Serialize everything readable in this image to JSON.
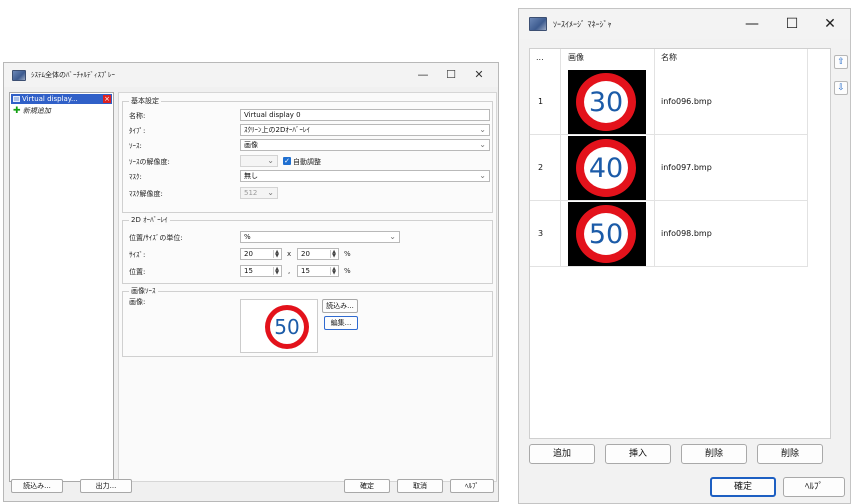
{
  "dialog": {
    "title": "ｼｽﾃﾑ全体のﾊﾞｰﾁｬﾙﾃﾞｨｽﾌﾟﾚｰ",
    "tree": {
      "selected": "Virtual display...",
      "add_new": "新規追加"
    },
    "basic": {
      "group_title": "基本設定",
      "name_label": "名称:",
      "name_value": "Virtual display 0",
      "type_label": "ﾀｲﾌﾟ:",
      "type_value": "ｽｸﾘｰﾝ上の2Dｵｰﾊﾞｰﾚｲ",
      "source_label": "ｿｰｽ:",
      "source_value": "画像",
      "resolution_label": "ｿｰｽの解像度:",
      "resolution_value": "",
      "auto_adjust_label": "自動調整",
      "auto_adjust_checked": true,
      "mask_label": "ﾏｽｸ:",
      "mask_value": "無し",
      "mask_res_label": "ﾏｽｸ解像度:",
      "mask_res_value": "512"
    },
    "overlay": {
      "group_title": "2D ｵｰﾊﾞｰﾚｲ",
      "unit_label": "位置/ｻｲｽﾞの単位:",
      "unit_value": "%",
      "size_label": "ｻｲｽﾞ:",
      "size_w": "20",
      "size_x_sep": "x",
      "size_h": "20",
      "size_unit": "%",
      "pos_label": "位置:",
      "pos_x": "15",
      "pos_sep": ",",
      "pos_y": "15",
      "pos_unit": "%"
    },
    "image_source": {
      "group_title": "画像ｿｰｽ",
      "image_label": "画像:",
      "preview_number": "50",
      "load_button": "読込み...",
      "edit_button": "編集..."
    },
    "footer": {
      "load": "読込み...",
      "export": "出力...",
      "ok": "確定",
      "cancel": "取消",
      "help": "ﾍﾙﾌﾟ"
    },
    "window_controls": {
      "min": "—",
      "max": "☐",
      "close": "✕"
    }
  },
  "manager": {
    "title": "ｿｰｽｲﾒｰｼﾞ ﾏﾈｰｼﾞｬ",
    "columns": {
      "index": "...",
      "image": "画像",
      "name": "名称"
    },
    "rows": [
      {
        "index": "1",
        "number": "30",
        "file": "info096.bmp"
      },
      {
        "index": "2",
        "number": "40",
        "file": "info097.bmp"
      },
      {
        "index": "3",
        "number": "50",
        "file": "info098.bmp"
      }
    ],
    "buttons": {
      "add": "追加",
      "insert": "挿入",
      "delete1": "削除",
      "delete2": "削除",
      "ok": "確定",
      "help": "ﾍﾙﾌﾟ"
    },
    "window_controls": {
      "min": "—",
      "max": "☐",
      "close": "✕"
    },
    "colors": {
      "sign_red": "#e3121b",
      "sign_digits": "#1b5ba8",
      "accent": "#2f6ad0"
    }
  }
}
